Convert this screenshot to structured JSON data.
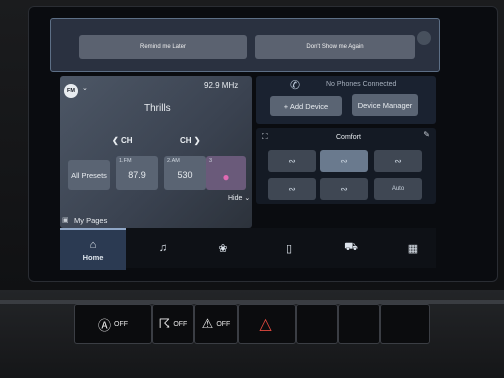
{
  "popup": {
    "remind_label": "Remind me Later",
    "dont_show_label": "Don't Show me Again"
  },
  "radio": {
    "band": "FM",
    "frequency": "92.9 MHz",
    "station": "Thrills",
    "ch_label": "CH",
    "all_presets_label": "All Presets",
    "presets": [
      {
        "num": "1.FM",
        "value": "87.9"
      },
      {
        "num": "2.AM",
        "value": "530"
      },
      {
        "num": "3",
        "value": ""
      }
    ],
    "hide_label": "Hide",
    "my_pages_label": "My Pages"
  },
  "phone": {
    "status": "No Phones Connected",
    "add_device_label": "+ Add Device",
    "device_manager_label": "Device Manager"
  },
  "climate": {
    "mode_label": "Comfort",
    "auto_label": "Auto"
  },
  "nav": {
    "home_label": "Home"
  },
  "switches": {
    "off_label": "OFF"
  }
}
